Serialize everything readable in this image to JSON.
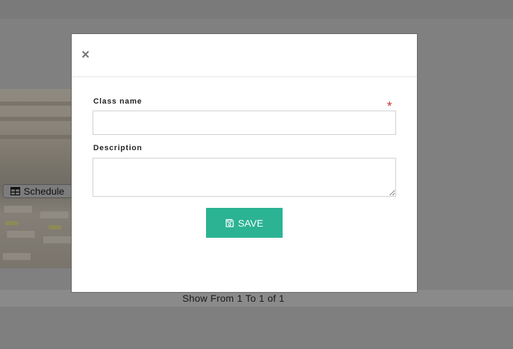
{
  "background": {
    "schedule_button_label": "Schedule",
    "pagination_text": "Show From 1 To 1 of 1"
  },
  "modal": {
    "close_symbol": "×",
    "class_name_label": "Class name",
    "class_name_value": "",
    "required_marker": "*",
    "description_label": "Description",
    "description_value": "",
    "save_label": "SAVE",
    "save_icon": "floppy-disk-icon"
  },
  "colors": {
    "save_button": "#2bb394",
    "required_marker": "#c9302c",
    "overlay": "#7f7f7f"
  }
}
